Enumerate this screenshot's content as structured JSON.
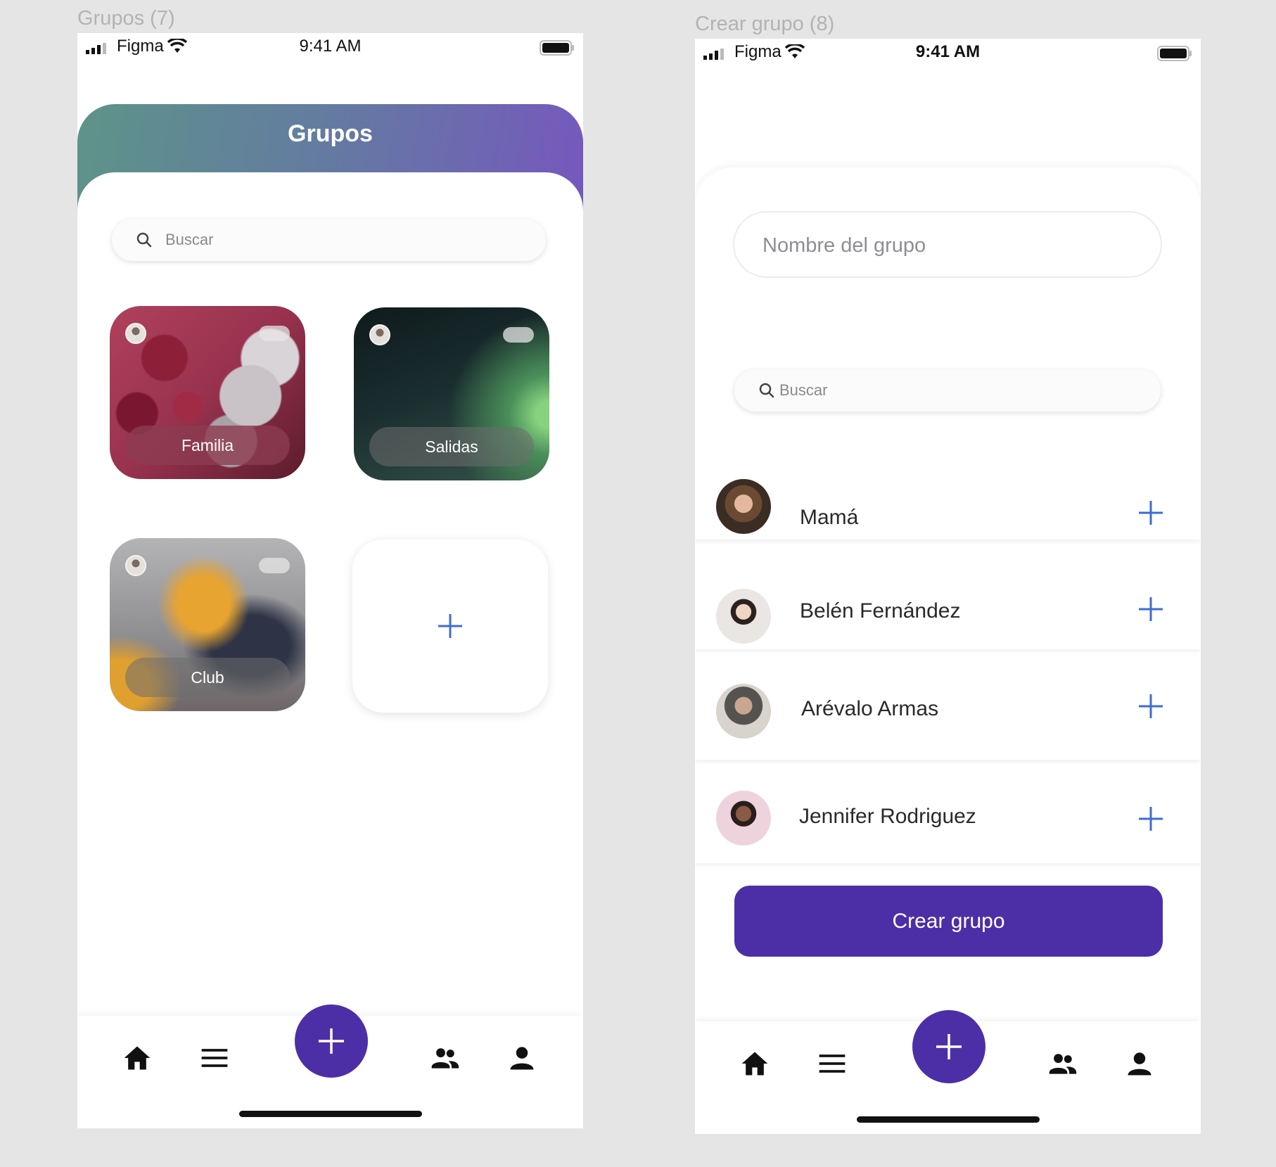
{
  "frames": {
    "left_label": "Grupos (7)",
    "right_label": "Crear grupo (8)"
  },
  "status_bar": {
    "carrier": "Figma",
    "time": "9:41 AM"
  },
  "grupos_screen": {
    "title": "Grupos",
    "search": {
      "placeholder": "Buscar"
    },
    "groups": [
      {
        "label": "Familia"
      },
      {
        "label": "Salidas"
      },
      {
        "label": "Club"
      }
    ],
    "add_group_icon": "plus-icon"
  },
  "crear_grupo_screen": {
    "name_input": {
      "placeholder": "Nombre del grupo"
    },
    "search": {
      "placeholder": "Buscar"
    },
    "contacts": [
      {
        "name": "Mamá"
      },
      {
        "name": "Belén Fernández"
      },
      {
        "name": "Arévalo Armas"
      },
      {
        "name": "Jennifer Rodriguez"
      }
    ],
    "create_button": "Crear grupo"
  },
  "bottom_nav": {
    "items": [
      "home-icon",
      "menu-icon",
      "add-fab",
      "group-icon",
      "profile-icon"
    ]
  },
  "colors": {
    "accent": "#4c2fa6",
    "plus_blue": "#3d6bd8",
    "header_gradient": [
      "#5d9488",
      "#7657be"
    ]
  }
}
